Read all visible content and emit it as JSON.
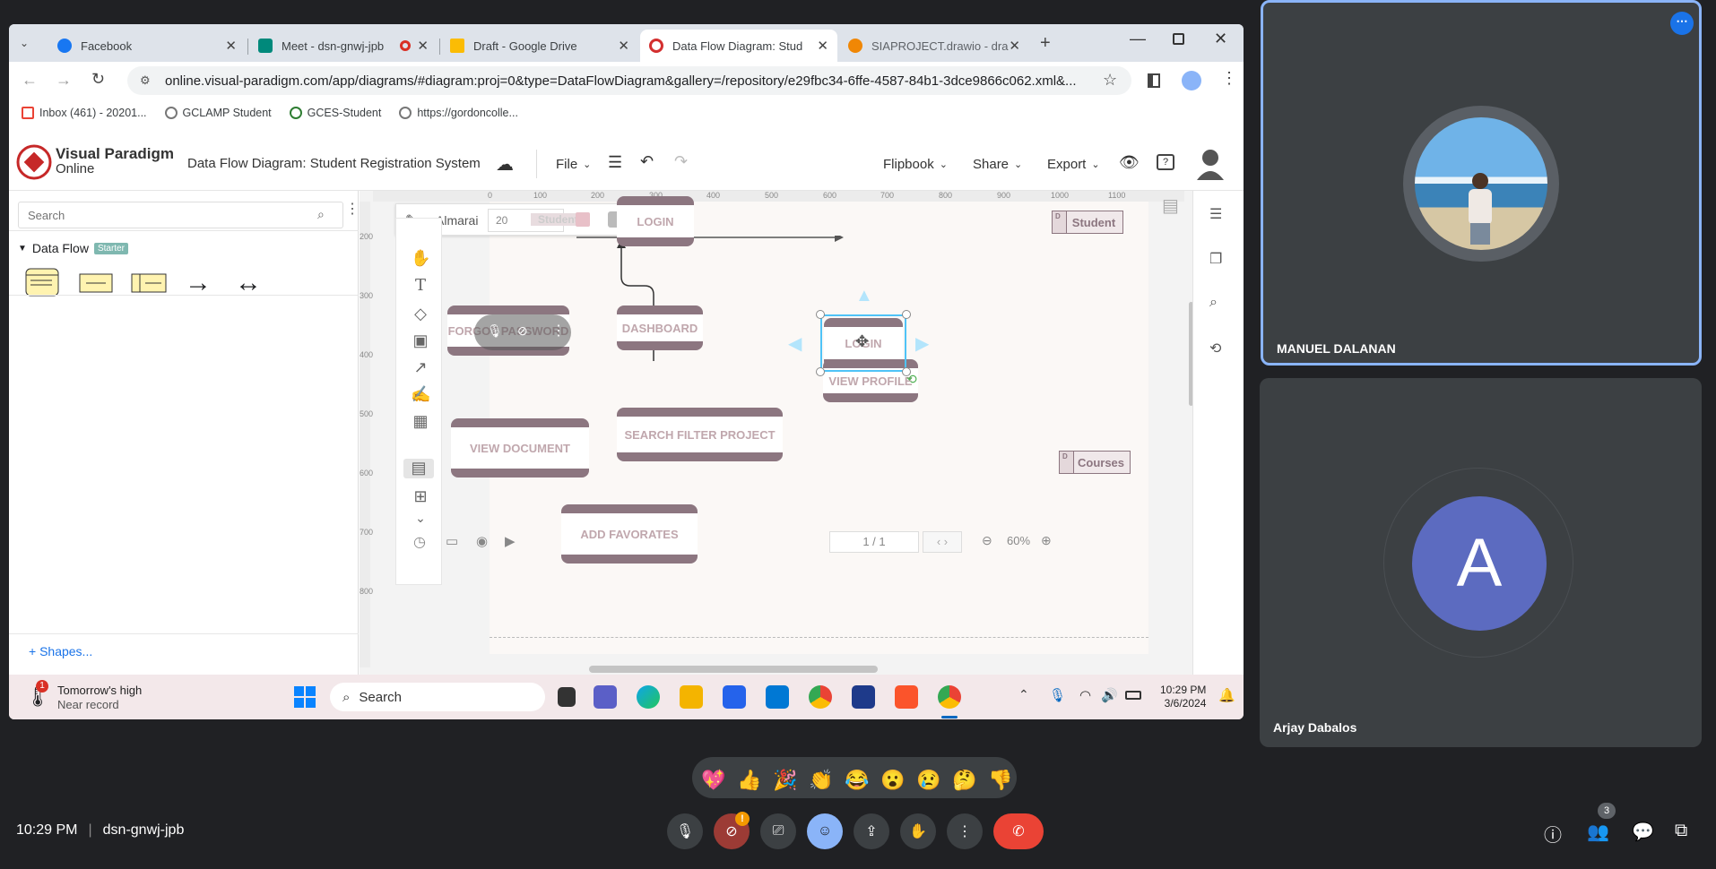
{
  "browser": {
    "tabs": [
      {
        "title": "Facebook",
        "icon": "facebook-icon",
        "color": "#1877f2"
      },
      {
        "title": "Meet - dsn-gnwj-jpb",
        "icon": "meet-icon",
        "color": "#00897b"
      },
      {
        "title": "Draft - Google Drive",
        "icon": "drive-icon",
        "color": "#fbbc04"
      },
      {
        "title": "Data Flow Diagram: Stud",
        "icon": "visual-paradigm-icon",
        "color": "#d32f2f"
      },
      {
        "title": "SIAPROJECT.drawio - dra",
        "icon": "drawio-icon",
        "color": "#f08705"
      }
    ],
    "url": "online.visual-paradigm.com/app/diagrams/#diagram:proj=0&type=DataFlowDiagram&gallery=/repository/e29fbc34-6ffe-4587-84b1-3dce9866c062.xml&...",
    "bookmarks": [
      "Inbox (461) - 20201...",
      "GCLAMP Student",
      "GCES-Student",
      "https://gordoncolle..."
    ]
  },
  "app": {
    "logo_line1": "Visual Paradigm",
    "logo_line2": "Online",
    "doc_title": "Data Flow Diagram: Student Registration System",
    "menu": {
      "file": "File",
      "flipbook": "Flipbook",
      "share": "Share",
      "export": "Export"
    }
  },
  "left_panel": {
    "search_placeholder": "Search",
    "category": "Data Flow",
    "badge": "Starter",
    "more_shapes": "+ Shapes..."
  },
  "canvas": {
    "ruler_top": [
      "0",
      "100",
      "200",
      "300",
      "400",
      "500",
      "600",
      "700",
      "800",
      "900",
      "1000",
      "1100"
    ],
    "ruler_left": [
      "200",
      "300",
      "400",
      "500",
      "600",
      "700",
      "800"
    ],
    "font_name": "Almarai",
    "font_size": "20",
    "floating_label": "Student",
    "processes": {
      "login_top": "LOGIN",
      "forgot_password": "FORGOT PASSWORD",
      "dashboard": "DASHBOARD",
      "login_selected": "LOGIN",
      "view_profile": "VIEW PROFILE",
      "view_document": "VIEW DOCUMENT",
      "search_filter": "SEARCH FILTER PROJECT",
      "add_favorates": "ADD FAVORATES"
    },
    "entities": {
      "student": "Student",
      "courses": "Courses",
      "entity_tag": "D"
    },
    "page_indicator": "1 / 1",
    "zoom": "60%"
  },
  "taskbar": {
    "weather_line1": "Tomorrow's high",
    "weather_line2": "Near record",
    "weather_badge": "1",
    "search": "Search",
    "time": "10:29 PM",
    "date": "3/6/2024"
  },
  "meet": {
    "participants": [
      {
        "name": "MANUEL DALANAN"
      },
      {
        "name": "Arjay Dabalos",
        "initial": "A",
        "avatar_color": "#5c6bc0"
      }
    ],
    "time": "10:29 PM",
    "meeting_code": "dsn-gnwj-jpb",
    "people_count": "3",
    "alert_badge": "!",
    "reactions": [
      "💖",
      "👍",
      "🎉",
      "👏",
      "😂",
      "😮",
      "😢",
      "🤔",
      "👎"
    ]
  }
}
